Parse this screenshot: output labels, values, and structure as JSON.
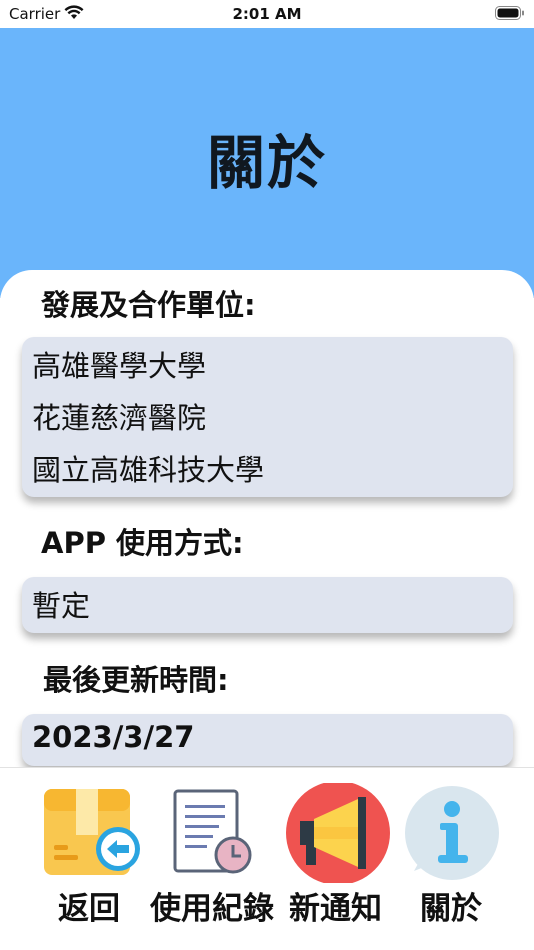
{
  "status_bar": {
    "carrier": "Carrier",
    "time": "2:01 AM"
  },
  "header": {
    "title": "關於"
  },
  "sections": {
    "partners_label": "發展及合作單位:",
    "partners": [
      "高雄醫學大學",
      "花蓮慈濟醫院",
      "國立高雄科技大學"
    ],
    "usage_label": "APP 使用方式:",
    "usage_value": "暫定",
    "updated_label": "最後更新時間:",
    "updated_value": "2023/3/27"
  },
  "tabs": [
    {
      "label": "返回",
      "icon": "box-back-icon"
    },
    {
      "label": "使用紀錄",
      "icon": "document-clock-icon"
    },
    {
      "label": "新通知",
      "icon": "megaphone-icon"
    },
    {
      "label": "關於",
      "icon": "info-icon"
    }
  ],
  "colors": {
    "header_bg": "#6ab5fb",
    "box_bg": "#dfe4ef",
    "megaphone_bg": "#ef5350",
    "info_bg": "#d9e6ee"
  }
}
